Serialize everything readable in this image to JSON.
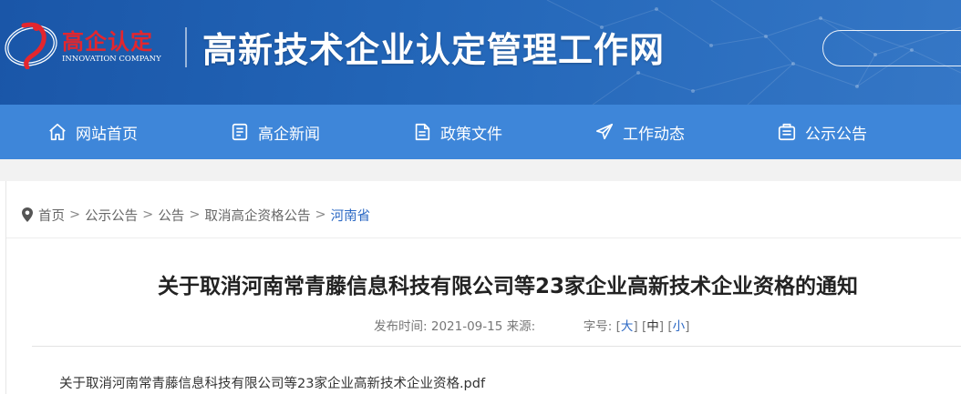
{
  "header": {
    "logo_text": "高企认定",
    "logo_sub": "INNOVATION COMPANY",
    "site_title": "高新技术企业认定管理工作网",
    "search_placeholder": ""
  },
  "nav": {
    "items": [
      {
        "label": "网站首页",
        "icon": "home-icon"
      },
      {
        "label": "高企新闻",
        "icon": "news-icon"
      },
      {
        "label": "政策文件",
        "icon": "document-icon"
      },
      {
        "label": "工作动态",
        "icon": "send-icon"
      },
      {
        "label": "公示公告",
        "icon": "announcement-icon"
      }
    ]
  },
  "breadcrumb": {
    "items": [
      "首页",
      "公示公告",
      "公告",
      "取消高企资格公告",
      "河南省"
    ],
    "separator": ">"
  },
  "article": {
    "title": "关于取消河南常青藤信息科技有限公司等23家企业高新技术企业资格的通知",
    "publish_label": "发布时间:",
    "publish_date": "2021-09-15",
    "source_label": "来源:",
    "source_value": "",
    "font_size_label": "字号:",
    "font_sizes": [
      "大",
      "中",
      "小"
    ],
    "attachment": "关于取消河南常青藤信息科技有限公司等23家企业高新技术企业资格.pdf"
  },
  "colors": {
    "header_bg": "#1f5fb1",
    "nav_bg": "#3e86d9",
    "logo_red": "#e3262e",
    "link_blue": "#2b68c4"
  }
}
